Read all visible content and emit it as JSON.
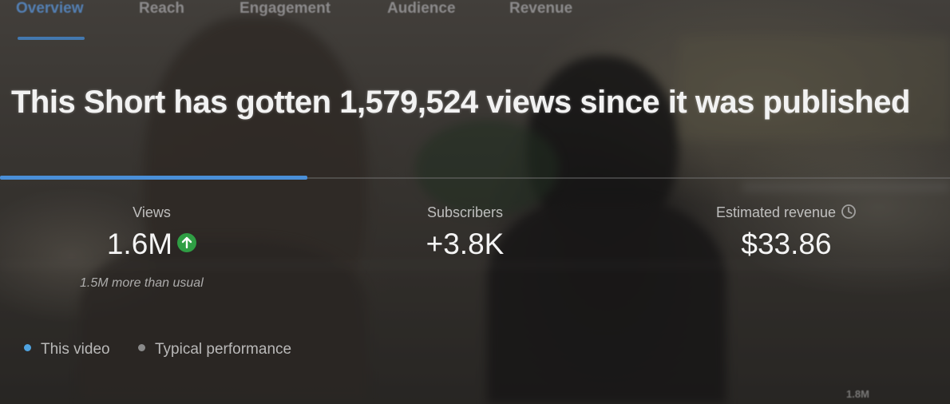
{
  "tabs": [
    {
      "label": "Overview",
      "active": true
    },
    {
      "label": "Reach",
      "active": false
    },
    {
      "label": "Engagement",
      "active": false
    },
    {
      "label": "Audience",
      "active": false
    },
    {
      "label": "Revenue",
      "active": false
    }
  ],
  "headline": "This Short has gotten 1,579,524 views since it was published",
  "metrics": {
    "views": {
      "label": "Views",
      "value": "1.6M",
      "trend_icon": "arrow-up-icon",
      "note": "1.5M more than usual"
    },
    "subscribers": {
      "label": "Subscribers",
      "value": "+3.8K"
    },
    "revenue": {
      "label": "Estimated revenue",
      "value": "$33.86",
      "info_icon": "clock-icon"
    }
  },
  "legend": [
    {
      "label": "This video",
      "color": "#4fa3e0"
    },
    {
      "label": "Typical performance",
      "color": "#8a8a8a"
    }
  ],
  "chart_axis_label": "1.8M",
  "colors": {
    "accent": "#4a8fd8",
    "trend_up": "#2f9e44"
  }
}
